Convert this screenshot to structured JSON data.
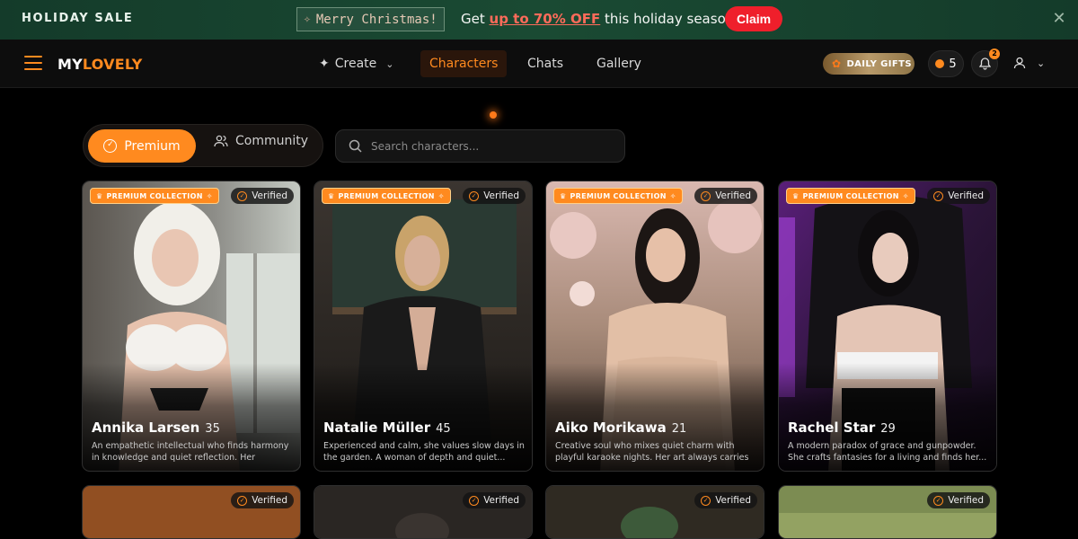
{
  "promo": {
    "sale_label": "HOLIDAY SALE",
    "tag_label": "Merry Christmas!",
    "message_prefix": "Get ",
    "message_highlight": "up to 70% OFF",
    "message_suffix": " this holiday season",
    "claim_label": "Claim"
  },
  "nav": {
    "logo_part1": "MY",
    "logo_part2": "LOVELY",
    "create_label": "Create",
    "characters_label": "Characters",
    "chats_label": "Chats",
    "gallery_label": "Gallery",
    "gifts_label": "DAILY GIFTS",
    "coins": "5",
    "notifications": "2"
  },
  "filters": {
    "premium_label": "Premium",
    "community_label": "Community",
    "search_placeholder": "Search characters..."
  },
  "badges": {
    "premium": "PREMIUM COLLECTION",
    "verified": "Verified"
  },
  "cards": [
    {
      "name": "Annika Larsen",
      "age": "35",
      "desc": "An empathetic intellectual who finds harmony in knowledge and quiet reflection. Her wisdom..."
    },
    {
      "name": "Natalie Müller",
      "age": "45",
      "desc": "Experienced and calm, she values slow days in the garden. A woman of depth and quiet..."
    },
    {
      "name": "Aiko Morikawa",
      "age": "21",
      "desc": "Creative soul who mixes quiet charm with playful karaoke nights. Her art always carries ..."
    },
    {
      "name": "Rachel Star",
      "age": "29",
      "desc": "A modern paradox of grace and gunpowder. She crafts fantasies for a living and finds her..."
    }
  ],
  "colors": {
    "accent": "#ff8a1f",
    "banner": "#1a4a33",
    "claim": "#ef1f2b"
  }
}
